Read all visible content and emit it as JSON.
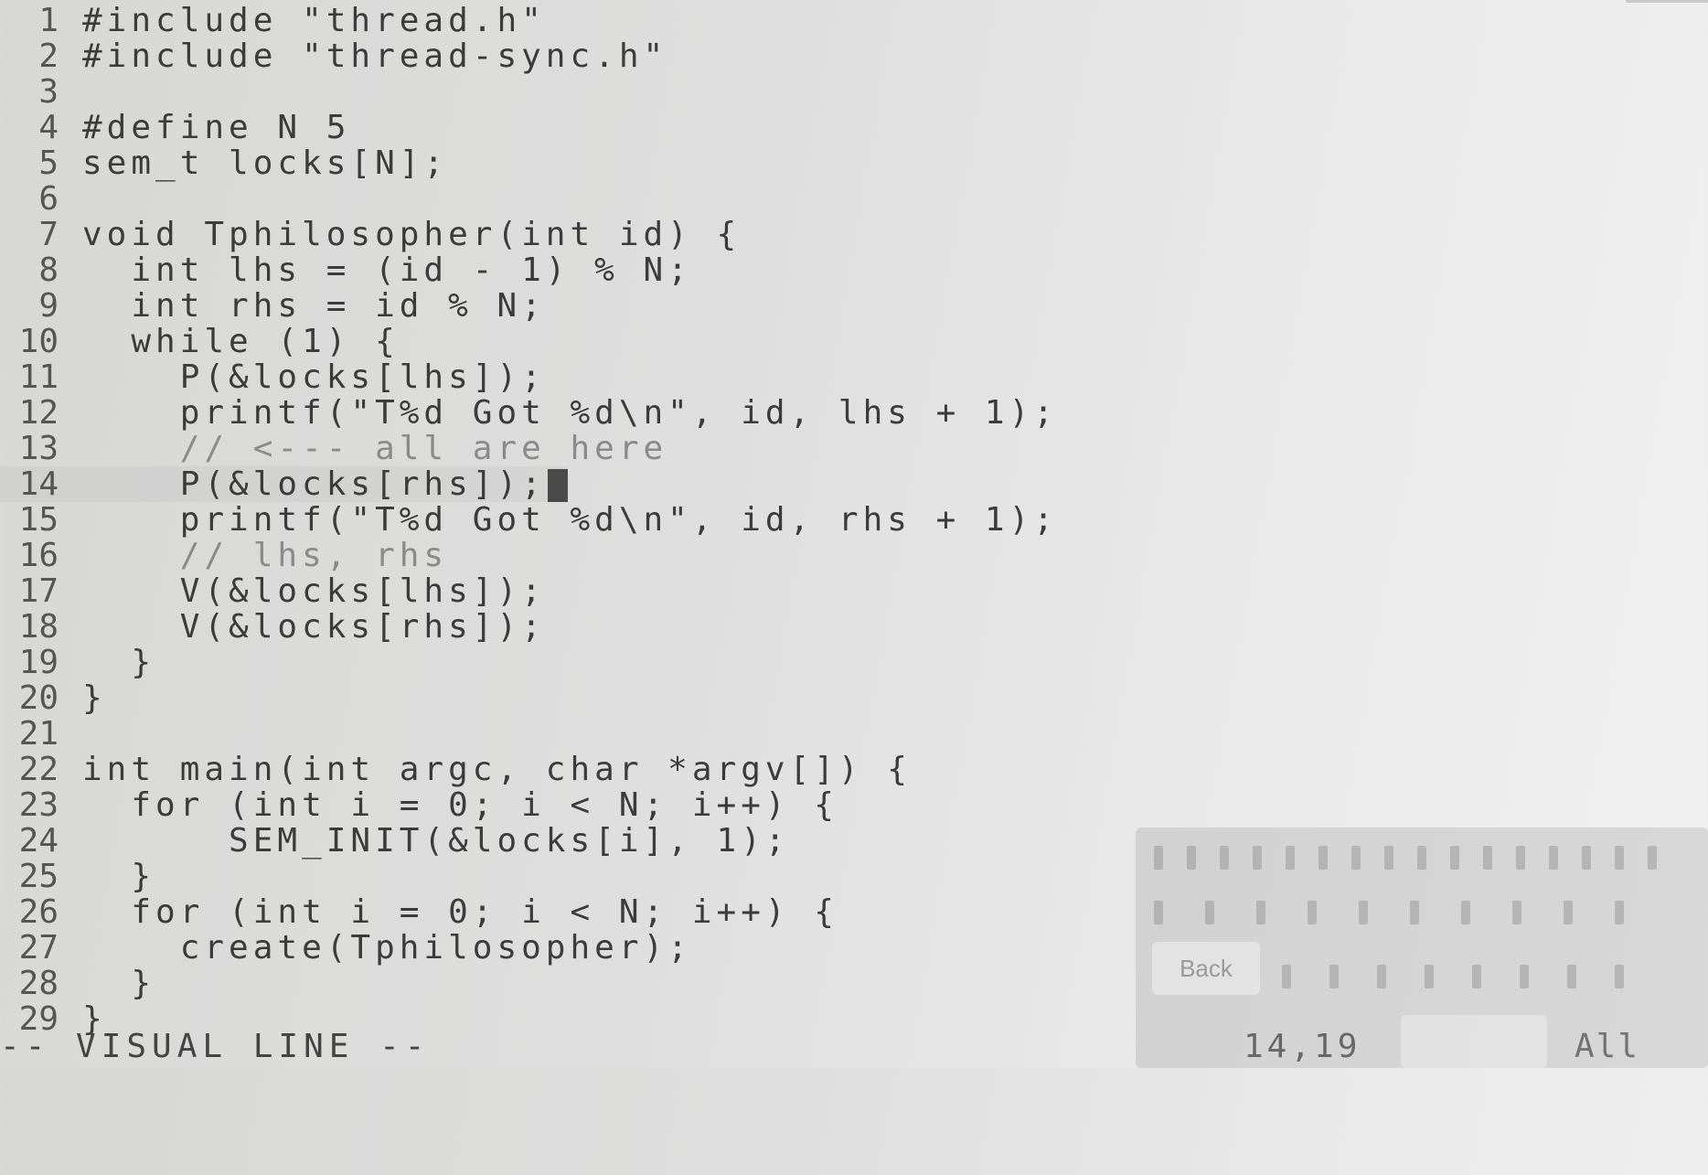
{
  "editor": {
    "lines": [
      {
        "n": "1",
        "code": "#include \"thread.h\""
      },
      {
        "n": "2",
        "code": "#include \"thread-sync.h\""
      },
      {
        "n": "3",
        "code": ""
      },
      {
        "n": "4",
        "code": "#define N 5"
      },
      {
        "n": "5",
        "code": "sem_t locks[N];"
      },
      {
        "n": "6",
        "code": ""
      },
      {
        "n": "7",
        "code": "void Tphilosopher(int id) {"
      },
      {
        "n": "8",
        "code": "  int lhs = (id - 1) % N;"
      },
      {
        "n": "9",
        "code": "  int rhs = id % N;"
      },
      {
        "n": "10",
        "code": "  while (1) {"
      },
      {
        "n": "11",
        "code": "    P(&locks[lhs]);"
      },
      {
        "n": "12",
        "code": "    printf(\"T%d Got %d\\n\", id, lhs + 1);"
      },
      {
        "n": "13",
        "code": "    // <--- all are here",
        "comment": true
      },
      {
        "n": "14",
        "code": "    P(&locks[rhs]);",
        "cursor": true
      },
      {
        "n": "15",
        "code": "    printf(\"T%d Got %d\\n\", id, rhs + 1);"
      },
      {
        "n": "16",
        "code": "    // lhs, rhs",
        "comment": true
      },
      {
        "n": "17",
        "code": "    V(&locks[lhs]);"
      },
      {
        "n": "18",
        "code": "    V(&locks[rhs]);"
      },
      {
        "n": "19",
        "code": "  }"
      },
      {
        "n": "20",
        "code": "}"
      },
      {
        "n": "21",
        "code": ""
      },
      {
        "n": "22",
        "code": "int main(int argc, char *argv[]) {"
      },
      {
        "n": "23",
        "code": "  for (int i = 0; i < N; i++) {"
      },
      {
        "n": "24",
        "code": "      SEM_INIT(&locks[i], 1);"
      },
      {
        "n": "25",
        "code": "  }"
      },
      {
        "n": "26",
        "code": "  for (int i = 0; i < N; i++) {"
      },
      {
        "n": "27",
        "code": "    create(Tphilosopher);"
      },
      {
        "n": "28",
        "code": "  }"
      },
      {
        "n": "29",
        "code": "}"
      }
    ]
  },
  "statusbar": {
    "mode": "-- VISUAL LINE --",
    "position": "14,19",
    "percent": "All"
  },
  "keyboard": {
    "back_label": "Back"
  }
}
